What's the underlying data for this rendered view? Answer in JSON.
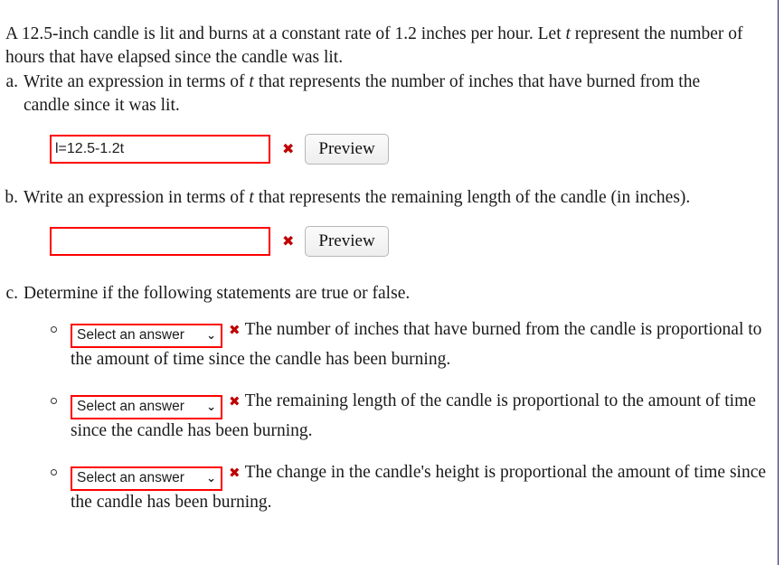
{
  "problem": {
    "intro_before_var": "A 12.5-inch candle is lit and burns at a constant rate of 1.2 inches per hour. Let ",
    "intro_var": "t",
    "intro_after_var": " represent the number of hours that have elapsed since the candle was lit."
  },
  "parts": {
    "a": {
      "label": "a.",
      "text_before_var": "Write an expression in terms of ",
      "var": "t",
      "text_after_var": " that represents the number of inches that have burned from the candle since it was lit.",
      "input_value": "l=12.5-1.2t",
      "input_placeholder": "",
      "error_mark": "✖",
      "preview_label": "Preview"
    },
    "b": {
      "label": "b.",
      "text_before_var": "Write an expression in terms of ",
      "var": "t",
      "text_after_var": " that represents the remaining length of the candle (in inches).",
      "input_value": "",
      "input_placeholder": "",
      "error_mark": "✖",
      "preview_label": "Preview"
    },
    "c": {
      "label": "c.",
      "text": "Determine if the following statements are true or false.",
      "select_label": "Select an answer",
      "select_chevron": "⌄",
      "error_mark": "✖",
      "statements": [
        {
          "select_value": "Select an answer",
          "text": "The number of inches that have burned from the candle is proportional to the amount of time since the candle has been burning."
        },
        {
          "select_value": "Select an answer",
          "text": "The remaining length of the candle is proportional to the amount of time since the candle has been burning."
        },
        {
          "select_value": "Select an answer",
          "text": "The change in the candle's height is proportional the amount of time since the candle has been burning."
        }
      ]
    }
  },
  "colors": {
    "error_red": "#ff0000",
    "mark_red": "#c00000",
    "page_background": "#ffffff",
    "edge_rule": "#1b1b6f"
  }
}
